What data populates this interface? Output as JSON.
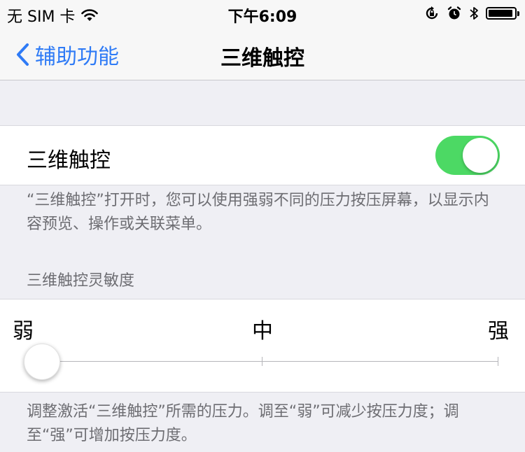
{
  "status_bar": {
    "carrier": "无 SIM 卡",
    "time": "下午6:09"
  },
  "nav": {
    "back_label": "辅助功能",
    "title": "三维触控"
  },
  "toggle": {
    "label": "三维触控",
    "state": "on",
    "on_color": "#4cd964"
  },
  "toggle_footer": "“三维触控”打开时，您可以使用强弱不同的压力按压屏幕，以显示内容预览、操作或关联菜单。",
  "sensitivity": {
    "header": "三维触控灵敏度",
    "labels": {
      "weak": "弱",
      "medium": "中",
      "strong": "强"
    },
    "selected": "弱",
    "value": 0
  },
  "sensitivity_footer": "调整激活“三维触控”所需的压力。调至“弱”可减少按压力度；调至“强”可增加按压力度。",
  "accent_color": "#2f7bf6"
}
